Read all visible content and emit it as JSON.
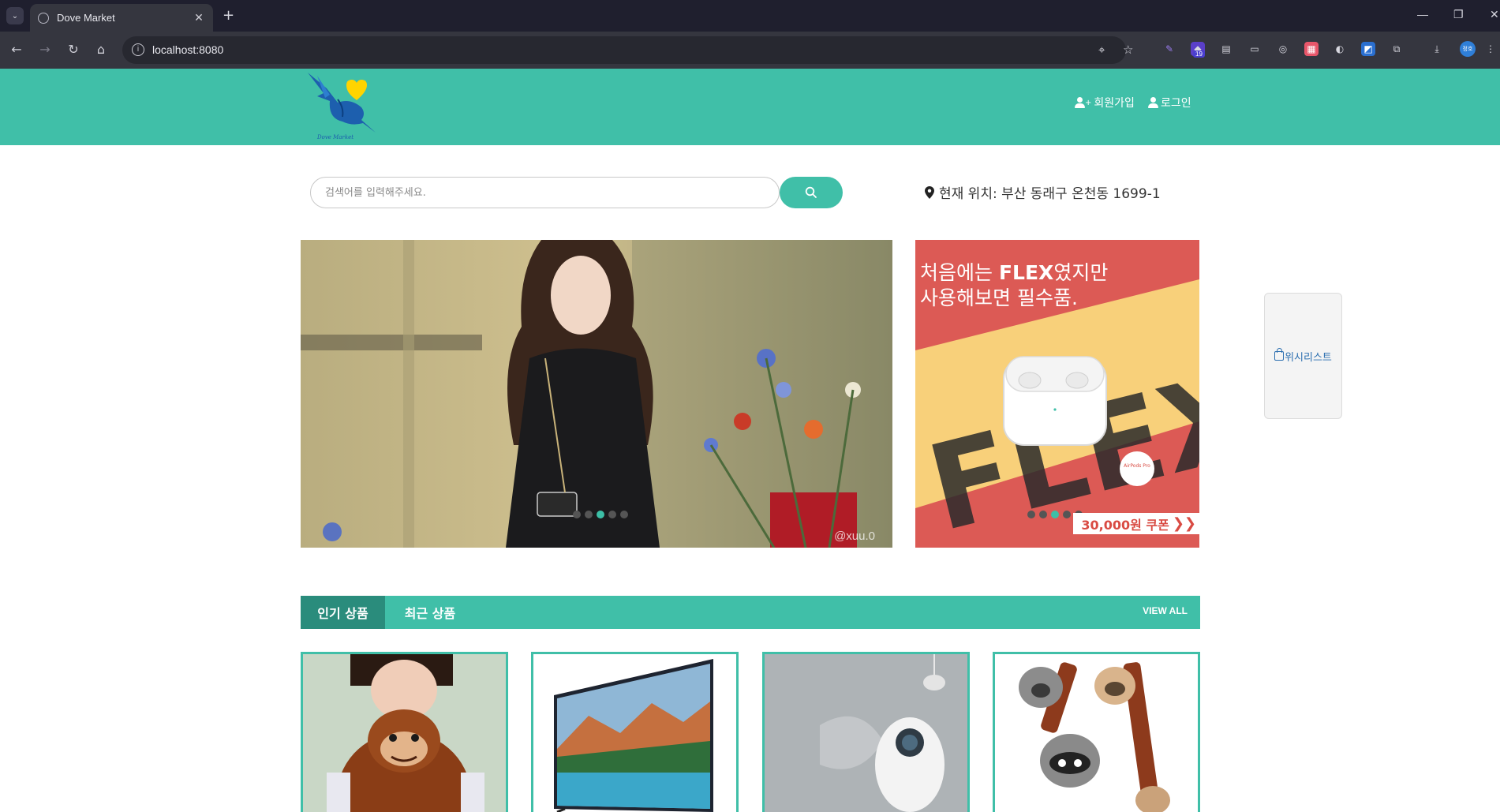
{
  "browser": {
    "tab_title": "Dove Market",
    "url": "localhost:8080",
    "extension_badge": "19",
    "profile_initials": "정호"
  },
  "header": {
    "logo_text": "Dove Market",
    "signup_label": "회원가입",
    "login_label": "로그인"
  },
  "search": {
    "placeholder": "검색어를 입력해주세요.",
    "value": ""
  },
  "location": {
    "text": "현재 위치: 부산 동래구 온천동 1699-1"
  },
  "hero": {
    "watermark": "@xuu.0",
    "slide_count": 5,
    "active_slide": 3
  },
  "promo": {
    "line1_prefix": "처음에는 ",
    "line1_bold": "FLEX",
    "line1_suffix": "였지만",
    "line2": "사용해보면 필수품.",
    "flex_word": "FLEX",
    "product_label": "AirPods Pro",
    "coupon_text": "30,000원 쿠폰",
    "coupon_chevron": "❯❯",
    "slide_count": 5,
    "active_slide": 3
  },
  "wishlist": {
    "label": "위시리스트"
  },
  "product_tabs": {
    "tabs": [
      {
        "label": "인기 상품",
        "active": true
      },
      {
        "label": "최근 상품",
        "active": false
      }
    ],
    "view_all": "VIEW ALL"
  },
  "products": [
    {
      "image": "plush-orangutan-image"
    },
    {
      "image": "tv-image"
    },
    {
      "image": "humidifier-image"
    },
    {
      "image": "plush-animals-image"
    }
  ],
  "colors": {
    "brand": "#40bfa8",
    "brand_dark": "#2a8c7c",
    "promo_red": "#dc5a55",
    "promo_yellow": "#f9d77c"
  }
}
